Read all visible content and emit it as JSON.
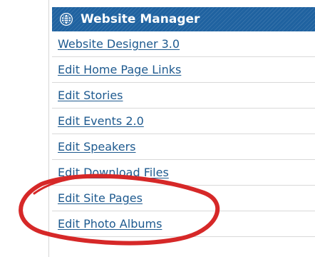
{
  "header": {
    "title": "Website Manager",
    "icon": "globe-icon",
    "background": "#1f62a0"
  },
  "menu": {
    "items": [
      {
        "label": "Website Designer 3.0"
      },
      {
        "label": "Edit Home Page Links"
      },
      {
        "label": "Edit Stories"
      },
      {
        "label": "Edit Events 2.0"
      },
      {
        "label": "Edit Speakers"
      },
      {
        "label": "Edit Download Files"
      },
      {
        "label": "Edit Site Pages"
      },
      {
        "label": "Edit Photo Albums"
      }
    ]
  },
  "annotation": {
    "type": "ellipse",
    "color": "#d62828",
    "target": "Edit Site Pages"
  }
}
